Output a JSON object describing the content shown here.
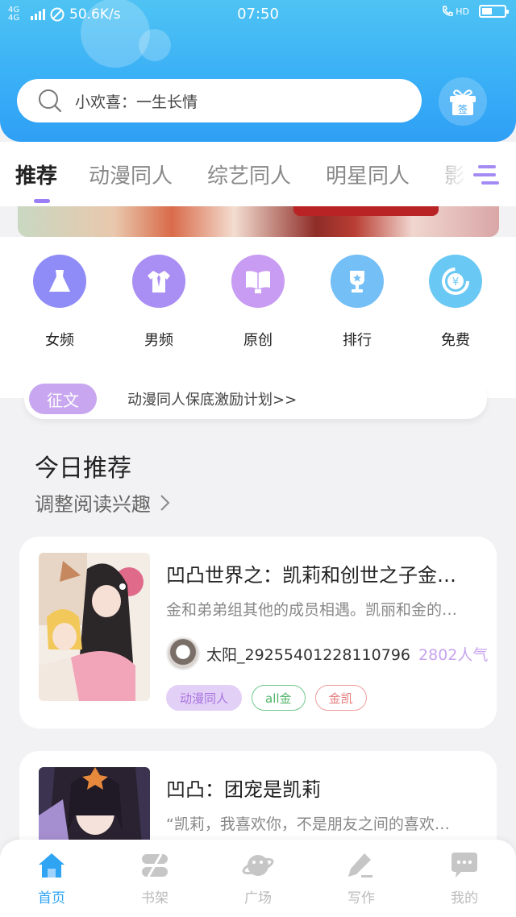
{
  "status_bar": {
    "network": "4G 4G",
    "speed": "50.6K/s",
    "time": "07:50",
    "hd": "HD"
  },
  "search": {
    "text": "小欢喜：一生长情"
  },
  "gift": {
    "label": "签"
  },
  "tabs": [
    "推荐",
    "动漫同人",
    "综艺同人",
    "明星同人",
    "影视"
  ],
  "categories": [
    {
      "label": "女频",
      "color": "#8f8cf7"
    },
    {
      "label": "男频",
      "color": "#a98ef3"
    },
    {
      "label": "原创",
      "color": "#c99cf3"
    },
    {
      "label": "排行",
      "color": "#73bff6"
    },
    {
      "label": "免费",
      "color": "#69c8f4"
    }
  ],
  "notice": {
    "pill": "征文",
    "text": "动漫同人保底激励计划>>"
  },
  "section": {
    "title": "今日推荐",
    "subtitle": "调整阅读兴趣"
  },
  "books": [
    {
      "title": "凹凸世界之：凯莉和创世之子金…",
      "desc": "金和弟弟组其他的成员相遇。凯丽和金的…",
      "author": "太阳_29255401228110796",
      "popularity": "2802人气",
      "tags": [
        {
          "label": "动漫同人",
          "color": "#a874de",
          "bg": "#e3d0f7",
          "border": "#e3d0f7"
        },
        {
          "label": "all金",
          "color": "#4fb469",
          "bg": "#ffffff",
          "border": "#72c98a"
        },
        {
          "label": "金凯",
          "color": "#e57a7a",
          "bg": "#ffffff",
          "border": "#ee9d9d"
        }
      ]
    },
    {
      "title": "凹凸：团宠是凯莉",
      "desc": "“凯莉，我喜欢你，不是朋友之间的喜欢…"
    }
  ],
  "bottom_nav": [
    "首页",
    "书架",
    "广场",
    "写作",
    "我的"
  ],
  "colors": {
    "accent": "#2fa4f2",
    "purple": "#9b7df6"
  }
}
